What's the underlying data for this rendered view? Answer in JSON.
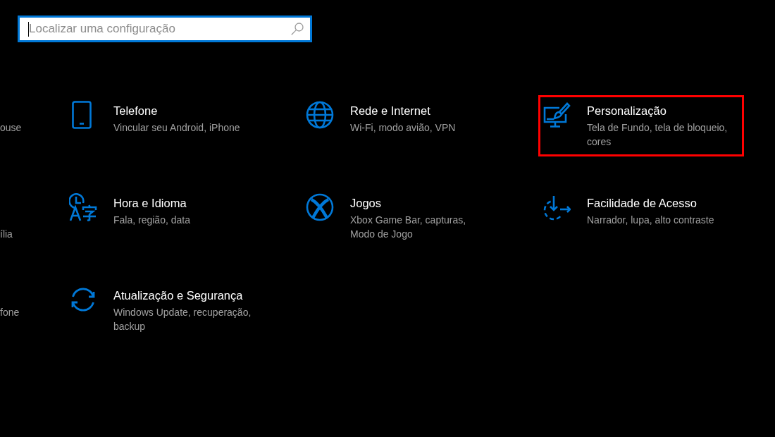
{
  "search": {
    "placeholder": "Localizar uma configuração",
    "focused": true
  },
  "partial_column": [
    {
      "description_tail": "ouse",
      "wrapped": false
    },
    {
      "description_tail": "ília",
      "wrapped": true
    },
    {
      "description_tail": "fone",
      "wrapped": false
    }
  ],
  "categories": [
    {
      "kind": "phone",
      "title": "Telefone",
      "description_lines": [
        "Vincular seu Android, iPhone"
      ],
      "highlighted": false
    },
    {
      "kind": "network",
      "title": "Rede e Internet",
      "description_lines": [
        "Wi-Fi, modo avião, VPN"
      ],
      "highlighted": false
    },
    {
      "kind": "personalization",
      "title": "Personalização",
      "description_lines": [
        "Tela de Fundo, tela de bloqueio,",
        "cores"
      ],
      "highlighted": true
    },
    {
      "kind": "time",
      "title": "Hora e Idioma",
      "description_lines": [
        "Fala, região, data"
      ],
      "highlighted": false
    },
    {
      "kind": "gaming",
      "title": "Jogos",
      "description_lines": [
        "Xbox Game Bar, capturas,",
        "Modo de Jogo"
      ],
      "highlighted": false
    },
    {
      "kind": "access",
      "title": "Facilidade de Acesso",
      "description_lines": [
        "Narrador, lupa, alto contraste"
      ],
      "highlighted": false
    },
    {
      "kind": "update",
      "title": "Atualização e Segurança",
      "description_lines": [
        "Windows Update, recuperação,",
        "backup"
      ],
      "highlighted": false
    }
  ]
}
